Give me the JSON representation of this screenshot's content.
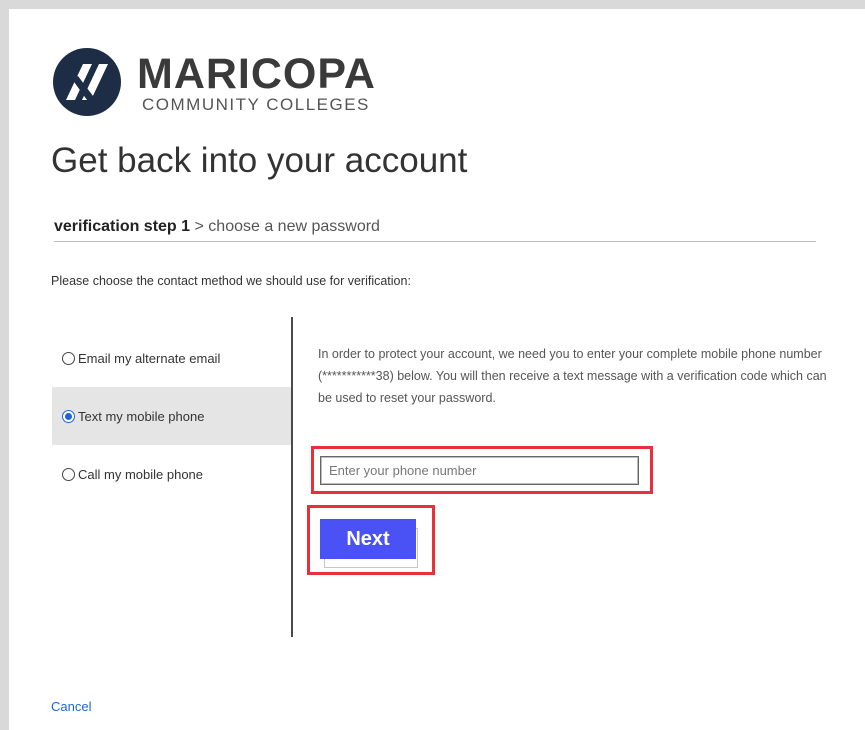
{
  "brand": {
    "name": "MARICOPA",
    "subtitle": "COMMUNITY COLLEGES",
    "logo_icon": "maricopa-logo-icon",
    "dark_color": "#1c2d45"
  },
  "page": {
    "title": "Get back into your account",
    "steps": {
      "current": "verification step 1",
      "separator": ">",
      "next": "choose a new password"
    },
    "instruction": "Please choose the contact method we should use for verification:"
  },
  "contact_methods": [
    {
      "label": "Email my alternate email",
      "selected": false
    },
    {
      "label": "Text my mobile phone",
      "selected": true
    },
    {
      "label": "Call my mobile phone",
      "selected": false
    }
  ],
  "details": {
    "description": "In order to protect your account, we need you to enter your complete mobile phone number (***********38) below. You will then receive a text message with a verification code which can be used to reset your password.",
    "phone_input": {
      "value": "",
      "placeholder": "Enter your phone number"
    },
    "next_label": "Next"
  },
  "cancel_label": "Cancel",
  "colors": {
    "accent_blue": "#4a51f5",
    "highlight_red": "#e8303a",
    "link_blue": "#1e66d0"
  }
}
